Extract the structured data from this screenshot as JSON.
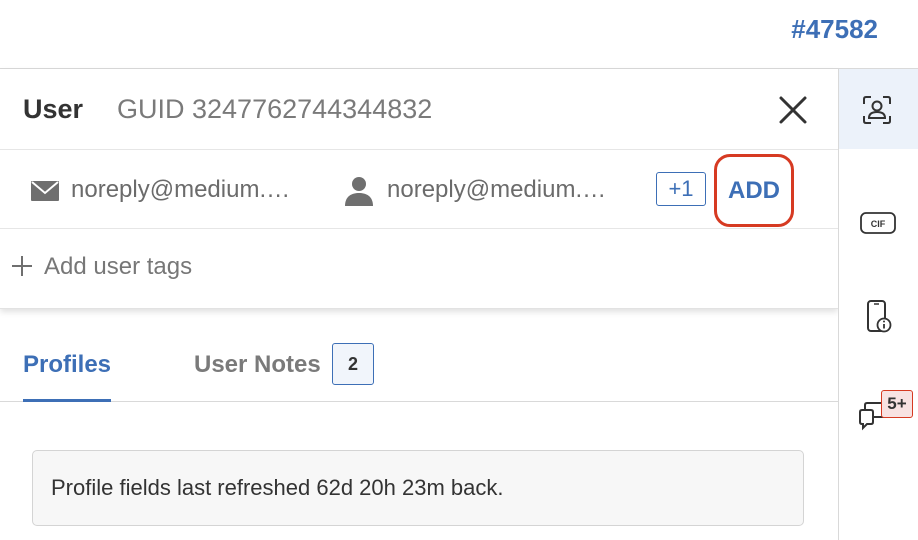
{
  "ticket": {
    "id": "#47582"
  },
  "user_card": {
    "title": "User",
    "guid": "GUID 3247762744344832",
    "close_icon": "close-icon",
    "contacts": [
      {
        "icon": "mail-icon",
        "value": "noreply@medium.…"
      },
      {
        "icon": "person-icon",
        "value": "noreply@medium.…"
      }
    ],
    "more_count": "+1",
    "add_label": "ADD",
    "add_tags_label": "Add user tags"
  },
  "tabs": [
    {
      "label": "Profiles",
      "active": true
    },
    {
      "label": "User Notes",
      "count": "2",
      "active": false
    }
  ],
  "info_message": "Profile fields last refreshed 62d 20h 23m back.",
  "right_rail": [
    {
      "icon": "user-scan-icon",
      "active": true
    },
    {
      "icon": "cif-icon",
      "label": "CIF"
    },
    {
      "icon": "phone-info-icon"
    },
    {
      "icon": "chat-icon",
      "badge": "5+"
    }
  ],
  "colors": {
    "accent": "#3d6fb6",
    "highlight": "#d63a22",
    "rail_active": "#ecf2fa"
  }
}
